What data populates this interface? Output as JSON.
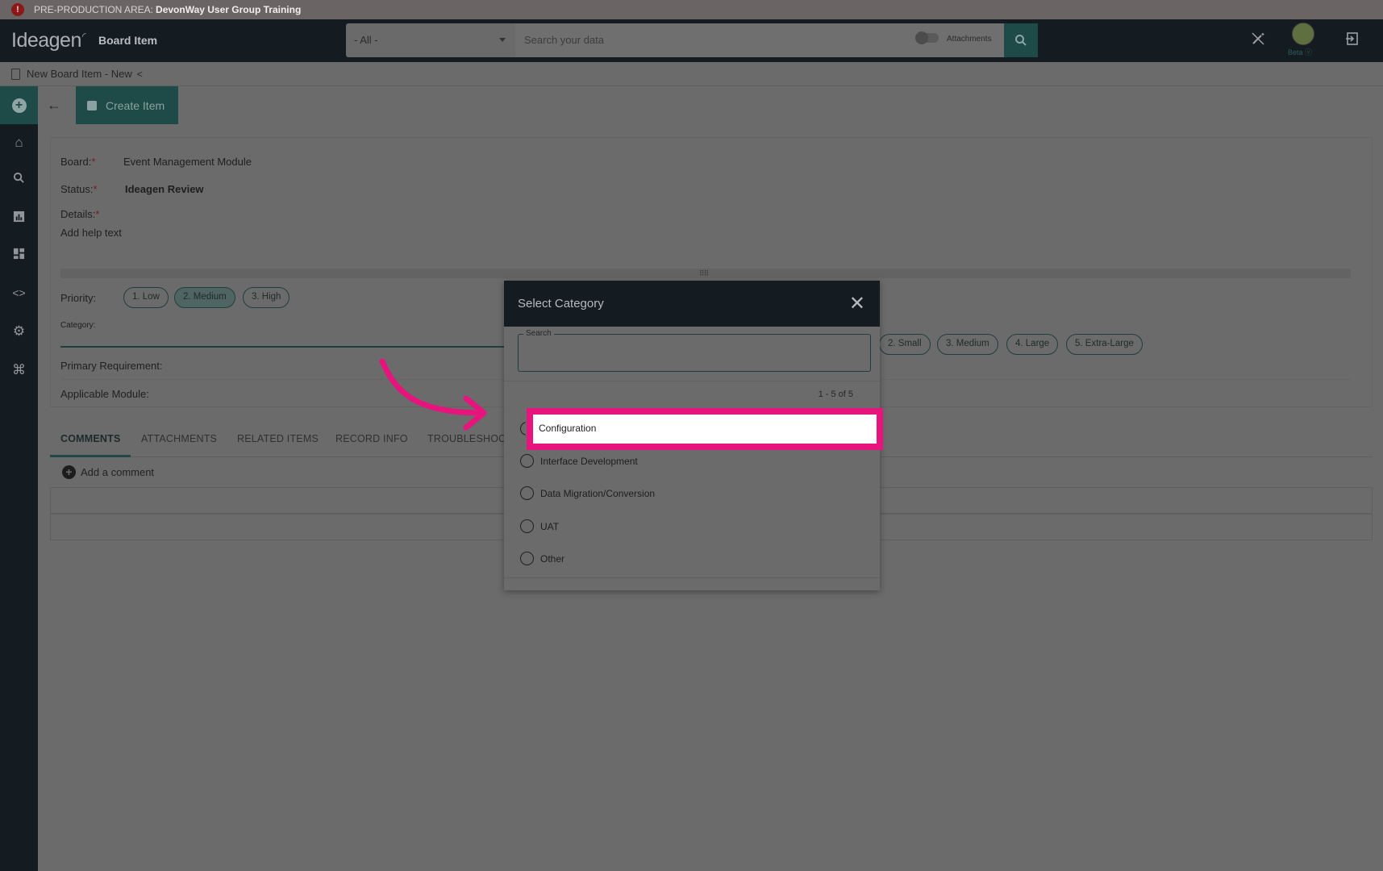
{
  "banner": {
    "prefix": "PRE-PRODUCTION AREA:",
    "name": "DevonWay User Group Training"
  },
  "topbar": {
    "logo": "Ideagen",
    "app_title": "Board Item",
    "scope_value": "- All -",
    "search_placeholder": "Search your data",
    "attachments_label": "Attachments",
    "beta_label": "Beta"
  },
  "breadcrumb": {
    "title": "New Board Item - New"
  },
  "toolbar": {
    "create_label": "Create Item"
  },
  "form": {
    "board_label": "Board:",
    "board_value": "Event Management Module",
    "status_label": "Status:",
    "status_value": "Ideagen Review",
    "details_label": "Details:",
    "details_help": "Add help text",
    "priority_label": "Priority:",
    "priority_options": [
      "1. Low",
      "2. Medium",
      "3. High"
    ],
    "priority_selected": "2. Medium",
    "category_label": "Category:",
    "size_options": [
      "2. Small",
      "3. Medium",
      "4. Large",
      "5. Extra-Large"
    ],
    "primary_requirement_label": "Primary Requirement:",
    "applicable_module_label": "Applicable Module:",
    "required_mark": "*"
  },
  "tabs": [
    "COMMENTS",
    "ATTACHMENTS",
    "RELATED ITEMS",
    "RECORD INFO",
    "TROUBLESHOO"
  ],
  "comments": {
    "add_label": "Add a comment"
  },
  "modal": {
    "title": "Select Category",
    "search_label": "Search",
    "count": "1 - 5 of 5",
    "options": [
      "Configuration",
      "Interface Development",
      "Data Migration/Conversion",
      "UAT",
      "Other"
    ],
    "highlighted_option": "Configuration"
  },
  "colors": {
    "highlight": "#e6147c",
    "accent": "#1e4a48",
    "topbar": "#141c22"
  }
}
